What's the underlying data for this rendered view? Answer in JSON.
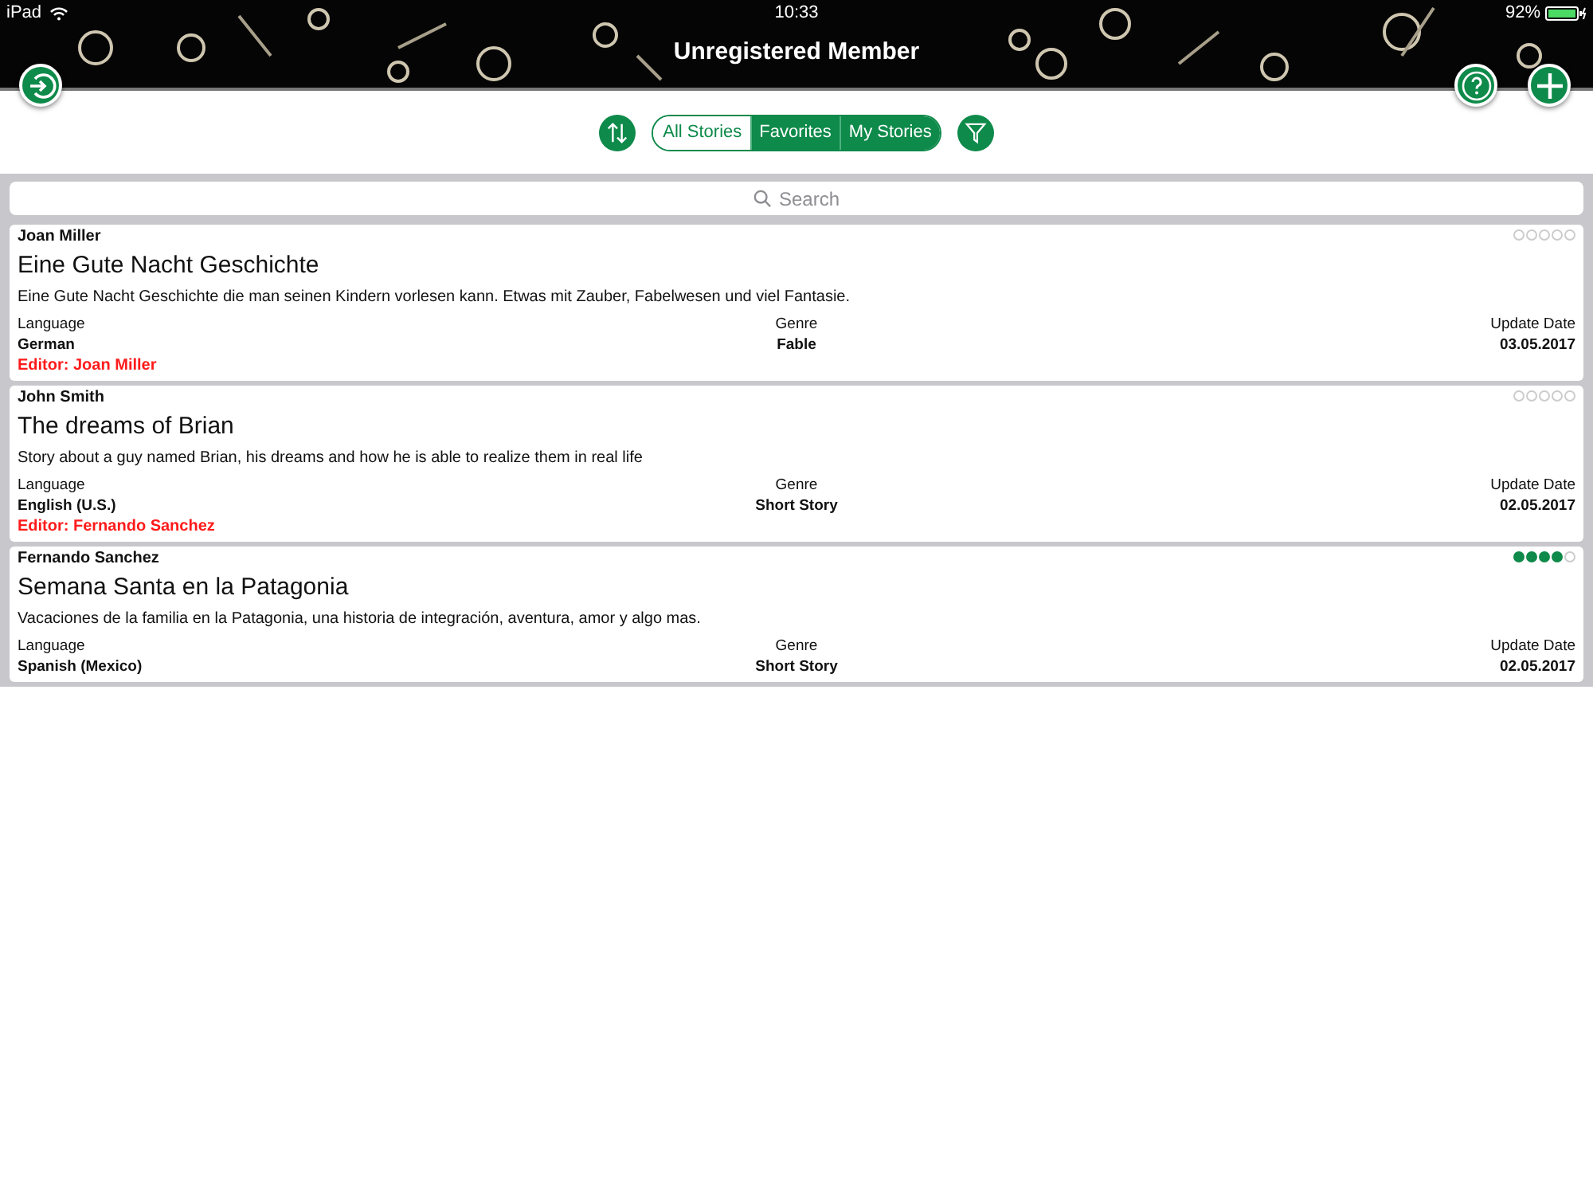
{
  "status_bar": {
    "device": "iPad",
    "time": "10:33",
    "battery": "92%"
  },
  "header": {
    "title": "Unregistered Member"
  },
  "tabs": [
    {
      "label": "All Stories",
      "selected": false
    },
    {
      "label": "Favorites",
      "selected": true
    },
    {
      "label": "My Stories",
      "selected": true
    }
  ],
  "search": {
    "placeholder": "Search"
  },
  "stories": [
    {
      "author": "Joan Miller",
      "title": "Eine Gute Nacht Geschichte",
      "description": "Eine Gute Nacht Geschichte die man seinen Kindern vorlesen kann. Etwas mit Zauber, Fabelwesen und viel Fantasie.",
      "language_label": "Language",
      "language": "German",
      "genre_label": "Genre",
      "genre": "Fable",
      "date_label": "Update Date",
      "date": "03.05.2017",
      "editor": "Editor: Joan Miller",
      "stars": 0
    },
    {
      "author": "John Smith",
      "title": "The dreams of Brian",
      "description": "Story about a guy named Brian, his dreams and how he is able to realize them in real life",
      "language_label": "Language",
      "language": "English (U.S.)",
      "genre_label": "Genre",
      "genre": "Short Story",
      "date_label": "Update Date",
      "date": "02.05.2017",
      "editor": "Editor: Fernando Sanchez",
      "stars": 0
    },
    {
      "author": "Fernando Sanchez",
      "title": "Semana Santa en la Patagonia",
      "description": "Vacaciones de la familia en la Patagonia, una historia de integración, aventura, amor y algo mas.",
      "language_label": "Language",
      "language": "Spanish (Mexico)",
      "genre_label": "Genre",
      "genre": "Short Story",
      "date_label": "Update Date",
      "date": "02.05.2017",
      "stars": 4
    }
  ]
}
